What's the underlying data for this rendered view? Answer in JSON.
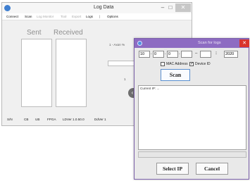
{
  "main_window": {
    "title": "Log Data",
    "menu": [
      {
        "label": "Connect",
        "enabled": true
      },
      {
        "label": "Scan",
        "enabled": true
      },
      {
        "label": "Log Monitor",
        "enabled": false
      },
      {
        "label": "Tool",
        "enabled": false
      },
      {
        "label": "Export",
        "enabled": false
      },
      {
        "label": "Logs",
        "enabled": true
      },
      {
        "label": "|",
        "enabled": false
      },
      {
        "label": "Options",
        "enabled": true
      }
    ],
    "sent_label": "Sent",
    "received_label": "Received",
    "partial_label": "1 - Axon %",
    "partial_label2": "1",
    "status": {
      "sn": "S/N",
      "cb": "CB",
      "ub": "UB",
      "fpga": "FPGA",
      "ld_ver": "LDVer 1.0.50.0",
      "dd_ver": "DdVer 1"
    }
  },
  "scan_dialog": {
    "title": "Scan for logs",
    "ip_start": [
      "10",
      "0",
      "0",
      ""
    ],
    "ip_end": "",
    "port": "2020",
    "options": [
      {
        "label": "MAC Address",
        "checked": false
      },
      {
        "label": "Device ID",
        "checked": true
      }
    ],
    "scan_label": "Scan",
    "current_ip_label": "Current IP: ...",
    "select_label": "Select IP",
    "cancel_label": "Cancel"
  },
  "colors": {
    "dialog_title_bar": "#8d6bc2",
    "close_button": "#d9342b",
    "scan_button_border": "#5a8fd0"
  }
}
